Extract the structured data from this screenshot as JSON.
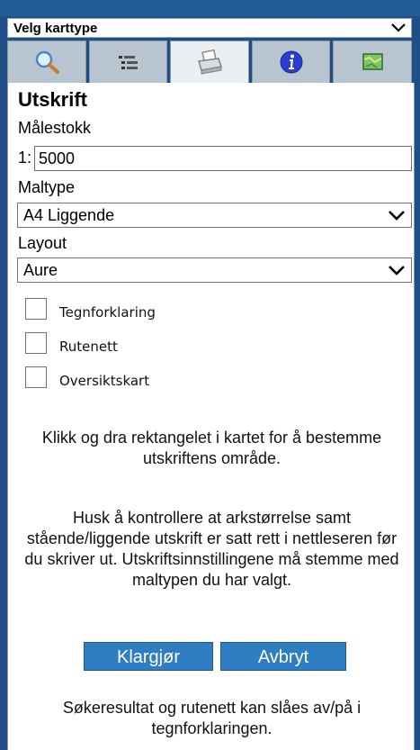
{
  "map_type_select": {
    "value": "Velg karttype"
  },
  "tabs": [
    {
      "name": "search",
      "icon": "search-icon"
    },
    {
      "name": "legend",
      "icon": "legend-icon"
    },
    {
      "name": "print",
      "icon": "printer-icon"
    },
    {
      "name": "info",
      "icon": "info-icon"
    },
    {
      "name": "map",
      "icon": "map-icon"
    }
  ],
  "print_panel": {
    "title": "Utskrift",
    "scale_label": "Målestokk",
    "scale_prefix": "1:",
    "scale_value": "5000",
    "template_label": "Maltype",
    "template_value": "A4 Liggende",
    "layout_label": "Layout",
    "layout_value": "Aure",
    "checkboxes": [
      {
        "label": "Tegnforklaring",
        "checked": false
      },
      {
        "label": "Rutenett",
        "checked": false
      },
      {
        "label": "Oversiktskart",
        "checked": false
      }
    ],
    "instruction": "Klikk og dra rektangelet i kartet for å bestemme utskriftens område.",
    "note": "Husk å kontrollere at arkstørrelse samt stående/liggende utskrift er satt rett i nettleseren før du skriver ut. Utskriftsinnstillingene må stemme med maltypen du har valgt.",
    "prepare_button": "Klargjør",
    "cancel_button": "Avbryt",
    "footer_note": "Søkeresultat og rutenett kan slåes av/på i tegnforklaringen."
  },
  "colors": {
    "button": "#2f7ec4",
    "header": "#1f5c98"
  }
}
